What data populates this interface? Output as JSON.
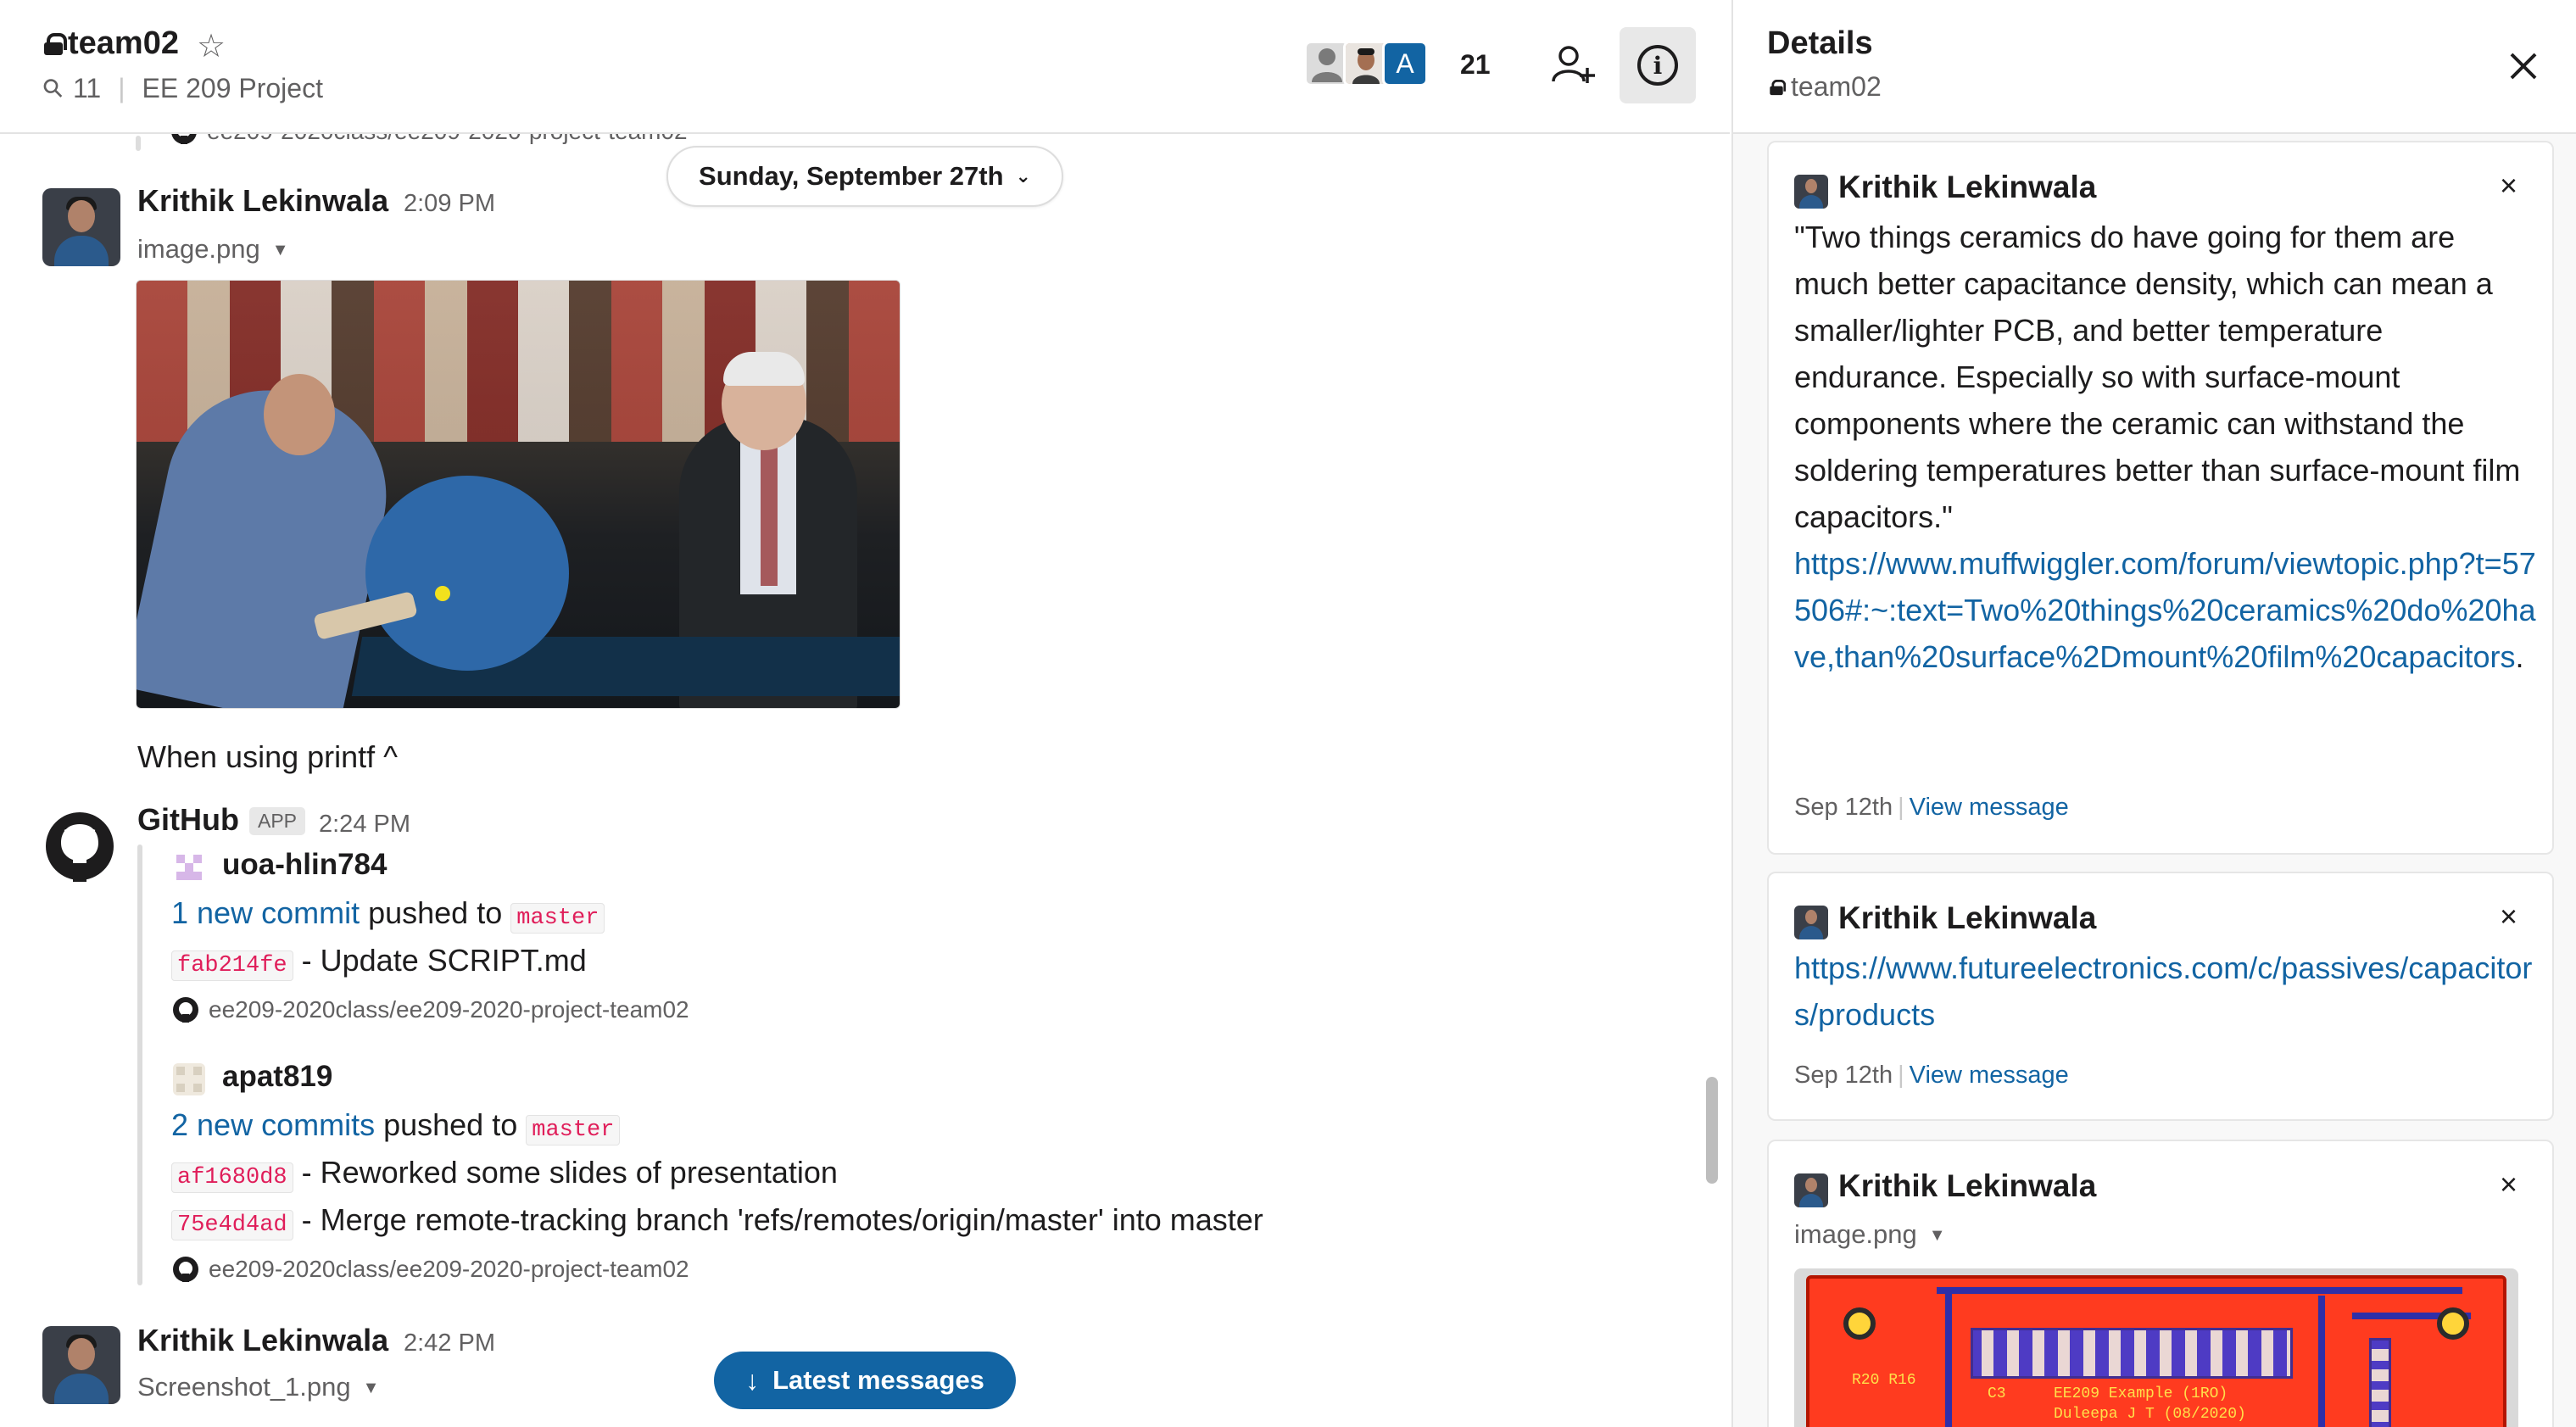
{
  "channel": {
    "name": "team02",
    "pinned_count": "11",
    "topic": "EE 209 Project",
    "member_count": "21",
    "member_initial": "A",
    "date_divider": "Sunday, September 27th",
    "truncated_repo": "ee209-2020class/ee209-2020-project-team02",
    "latest_label": "Latest messages"
  },
  "messages": [
    {
      "author": "Krithik Lekinwala",
      "time": "2:09 PM",
      "file": "image.png",
      "text": "When using printf ^"
    },
    {
      "author": "GitHub",
      "badge": "APP",
      "time": "2:24 PM",
      "attachments": [
        {
          "user": "uoa-hlin784",
          "summary_link": "1 new commit",
          "summary_rest": "pushed to",
          "branch": "master",
          "commits": [
            {
              "sha": "fab214fe",
              "msg": "- Update SCRIPT.md"
            }
          ],
          "repo": "ee209-2020class/ee209-2020-project-team02"
        },
        {
          "user": "apat819",
          "summary_link": "2 new commits",
          "summary_rest": "pushed to",
          "branch": "master",
          "commits": [
            {
              "sha": "af1680d8",
              "msg": "- Reworked some slides of presentation"
            },
            {
              "sha": "75e4d4ad",
              "msg": "- Merge remote-tracking branch 'refs/remotes/origin/master' into master"
            }
          ],
          "repo": "ee209-2020class/ee209-2020-project-team02"
        }
      ]
    },
    {
      "author": "Krithik Lekinwala",
      "time": "2:42 PM",
      "file": "Screenshot_1.png"
    }
  ],
  "details": {
    "title": "Details",
    "channel": "team02",
    "pins": [
      {
        "author": "Krithik Lekinwala",
        "quote": "\"Two things ceramics do have going for them are much better capacitance density, which can mean a smaller/lighter PCB, and better temperature endurance. Especially so with surface-mount components where the ceramic can withstand the soldering temperatures better than surface-mount film capacitors.\"",
        "link": "https://www.muffwiggler.com/forum/viewtopic.php?t=57506#:~:text=Two%20things%20ceramics%20do%20have,than%20surface%2Dmount%20film%20capacitors",
        "link_suffix": ".",
        "date": "Sep 12th",
        "view": "View message"
      },
      {
        "author": "Krithik Lekinwala",
        "link": "https://www.futureelectronics.com/c/passives/capacitors/products",
        "date": "Sep 12th",
        "view": "View message"
      },
      {
        "author": "Krithik Lekinwala",
        "file": "image.png",
        "pcb_label_1": "EE209 Example (1RO)",
        "pcb_label_2": "Duleepa J T (08/2020)",
        "pcb_label_3": "R20 R16",
        "pcb_label_4": "C3"
      }
    ]
  }
}
